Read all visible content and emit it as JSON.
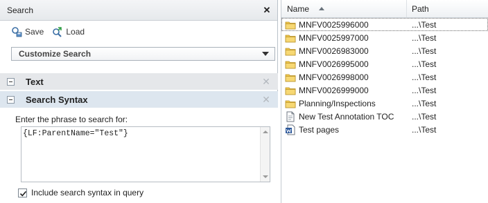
{
  "search_panel": {
    "title": "Search",
    "save_label": "Save",
    "load_label": "Load",
    "customize_label": "Customize Search",
    "sections": [
      {
        "label": "Text"
      },
      {
        "label": "Search Syntax"
      }
    ],
    "phrase_label": "Enter the phrase to search for:",
    "phrase_value": "{LF:ParentName=\"Test\"}",
    "include_syntax_label": "Include search syntax in query",
    "include_syntax_checked": true
  },
  "file_list": {
    "columns": {
      "name": "Name",
      "path": "Path"
    },
    "rows": [
      {
        "name": "MNFV0025996000",
        "path": "...\\Test",
        "icon": "folder-icon",
        "selected": true
      },
      {
        "name": "MNFV0025997000",
        "path": "...\\Test",
        "icon": "folder-icon"
      },
      {
        "name": "MNFV0026983000",
        "path": "...\\Test",
        "icon": "folder-icon"
      },
      {
        "name": "MNFV0026995000",
        "path": "...\\Test",
        "icon": "folder-icon"
      },
      {
        "name": "MNFV0026998000",
        "path": "...\\Test",
        "icon": "folder-icon"
      },
      {
        "name": "MNFV0026999000",
        "path": "...\\Test",
        "icon": "folder-icon"
      },
      {
        "name": "Planning/Inspections",
        "path": "...\\Test",
        "icon": "folder-icon"
      },
      {
        "name": "New Test Annotation TOC",
        "path": "...\\Test",
        "icon": "document-icon"
      },
      {
        "name": "Test pages",
        "path": "...\\Test",
        "icon": "word-document-icon"
      }
    ]
  },
  "colors": {
    "folder": "#f2c94c",
    "section_header": "#dde6ef",
    "word_icon": "#2b579a"
  }
}
